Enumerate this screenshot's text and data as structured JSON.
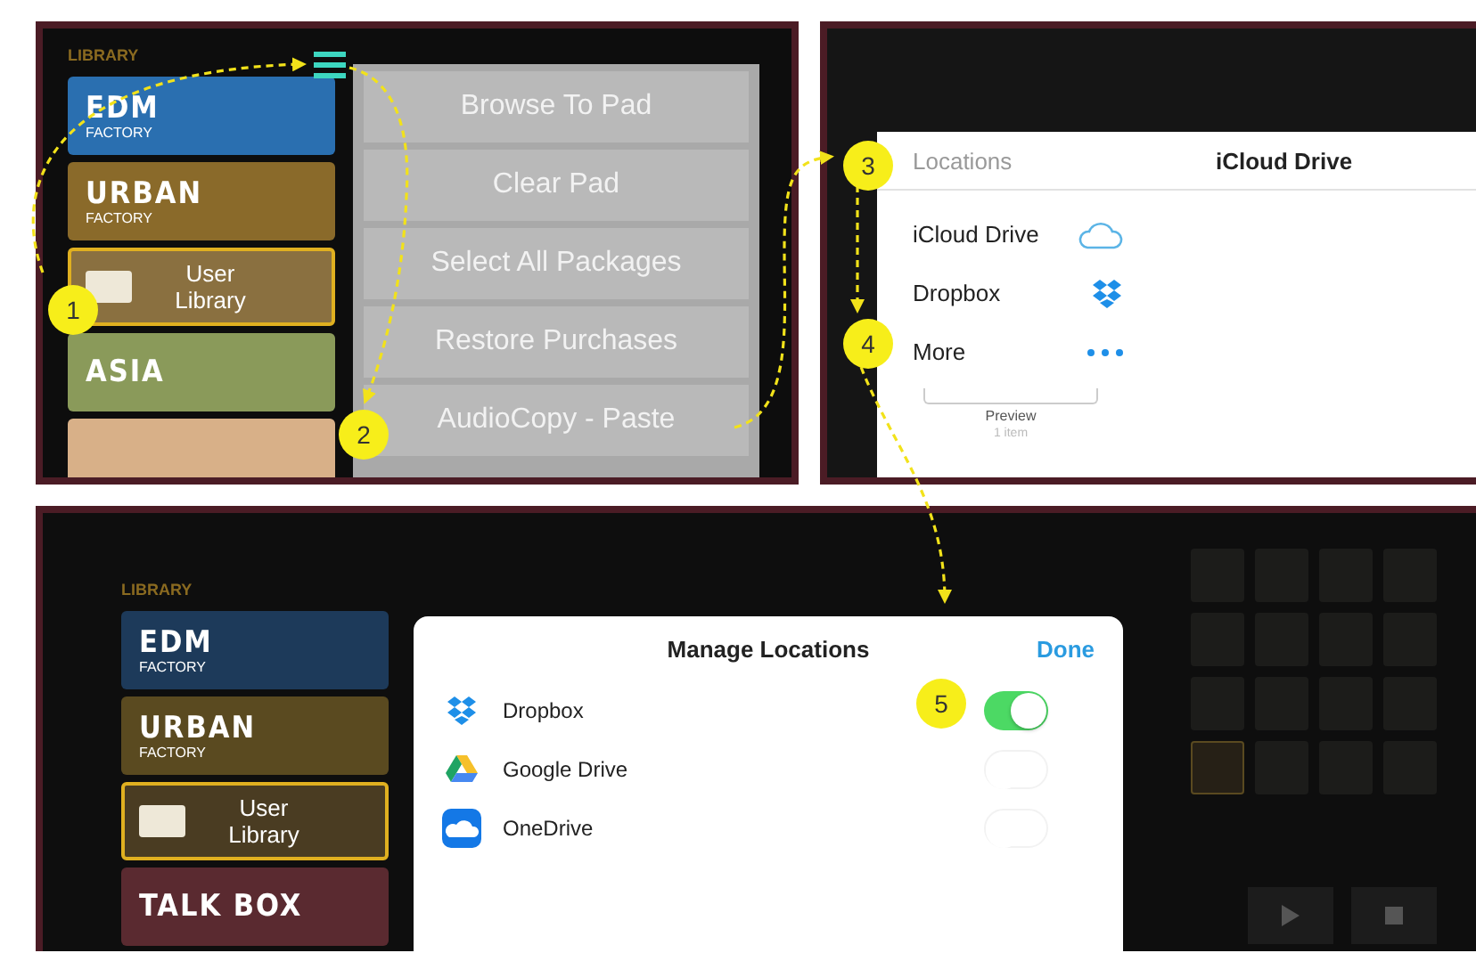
{
  "library_top": {
    "heading": "LIBRARY",
    "tiles": [
      {
        "kind": "art",
        "title": "EDM",
        "subtitle": "FACTORY",
        "color": "#2a6fb0",
        "selected": false
      },
      {
        "kind": "art",
        "title": "URBAN",
        "subtitle": "FACTORY",
        "color": "#8a6a2a",
        "selected": false
      },
      {
        "kind": "folder",
        "title": "User Library",
        "color": "#8a7040",
        "selected": true
      },
      {
        "kind": "art",
        "title": "ASIA",
        "color": "#8a9a5a",
        "selected": false
      },
      {
        "kind": "art",
        "color": "#d8b088",
        "selected": false
      }
    ]
  },
  "menu": {
    "items": [
      "Browse To Pad",
      "Clear Pad",
      "Select All Packages",
      "Restore Purchases",
      "AudioCopy - Paste"
    ]
  },
  "picker": {
    "sidebar_title": "Locations",
    "title": "iCloud Drive",
    "locations": [
      {
        "name": "iCloud Drive",
        "kind": "cloud"
      },
      {
        "name": "Dropbox",
        "kind": "dropbox"
      },
      {
        "name": "More",
        "kind": "more"
      }
    ],
    "preview_label": "Preview",
    "preview_count": "1 item"
  },
  "library_bottom": {
    "heading": "LIBRARY",
    "tiles": [
      {
        "kind": "art",
        "title": "EDM",
        "subtitle": "FACTORY",
        "color": "#1d3a5a",
        "selected": false
      },
      {
        "kind": "art",
        "title": "URBAN",
        "subtitle": "FACTORY",
        "color": "#5a4a20",
        "selected": false
      },
      {
        "kind": "folder",
        "title": "User Library",
        "color": "#4a3c22",
        "selected": true
      },
      {
        "kind": "art",
        "title": "TALK BOX",
        "color": "#5a2a30",
        "selected": false
      }
    ]
  },
  "manage": {
    "title": "Manage Locations",
    "done": "Done",
    "services": [
      {
        "name": "Dropbox",
        "kind": "dropbox",
        "on": true
      },
      {
        "name": "Google Drive",
        "kind": "gdrive",
        "on": false
      },
      {
        "name": "OneDrive",
        "kind": "onedrive",
        "on": false
      }
    ]
  },
  "callouts": [
    "1",
    "2",
    "3",
    "4",
    "5"
  ]
}
